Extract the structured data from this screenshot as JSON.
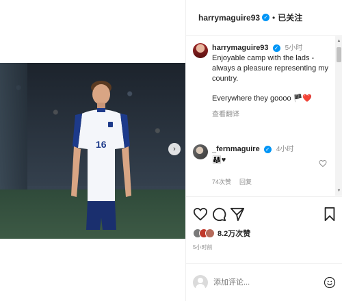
{
  "post": {
    "username": "harrymaguire93",
    "separator": "•",
    "follow_label": "已关注",
    "caption": {
      "time": "5小时",
      "line_1": "Enjoyable camp with the lads -",
      "line_2": "always a pleasure representing my",
      "line_3": "country.",
      "line_4": "Everywhere they goooo 🏴❤️",
      "translate": "查看翻译"
    },
    "comment": {
      "username": "_fernmaguire",
      "time": "4小时",
      "text": "👨‍👩‍👧♥",
      "likes": "74次赞",
      "reply": "回复"
    },
    "likes": "8.2万次赞",
    "posted": "5小时前",
    "add_comment_placeholder": "添加评论..."
  },
  "media": {
    "jersey_number": "16",
    "carousel_dots": 4,
    "active_dot": 1
  },
  "colors": {
    "verified": "#0095f6",
    "text": "#262626",
    "muted": "#8e8e8e",
    "divider": "#efefef"
  },
  "icons": [
    "verified-icon",
    "heart-icon",
    "comment-icon",
    "share-icon",
    "bookmark-icon",
    "smile-icon",
    "next-arrow-icon"
  ]
}
